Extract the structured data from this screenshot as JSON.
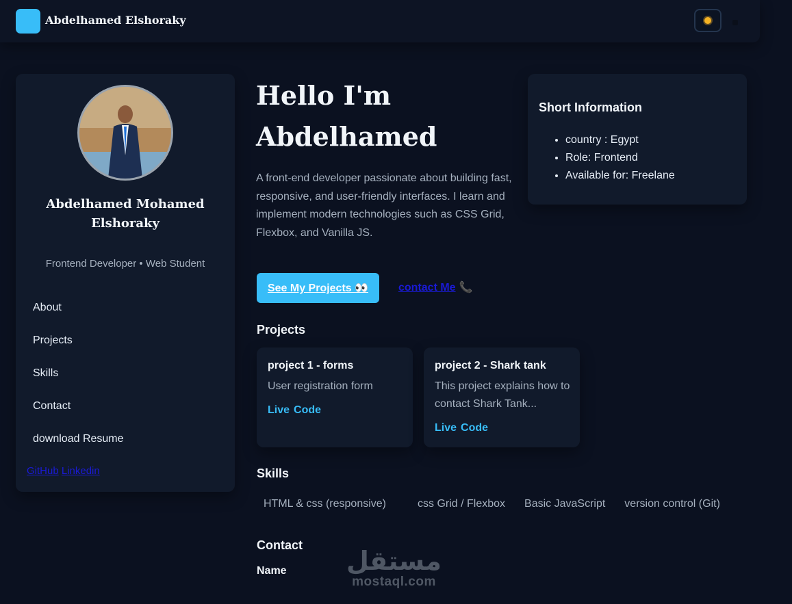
{
  "header": {
    "brand": "Abdelhamed Elshoraky",
    "theme_icon": "sun-icon"
  },
  "sidebar": {
    "name": "Abdelhamed Mohamed Elshoraky",
    "subtitle": "Frontend Developer • Web Student",
    "nav": [
      "About",
      "Projects",
      "Skills",
      "Contact",
      "download Resume"
    ],
    "links": [
      "GitHub",
      "Linkedin"
    ]
  },
  "hero": {
    "title_line1": "Hello I'm",
    "title_line2": "Abdelhamed",
    "description": "A front-end developer passionate about building fast, responsive, and user-friendly interfaces. I learn and implement modern technologies such as CSS Grid, Flexbox, and Vanilla JS.",
    "primary_button": "See My Projects 👀",
    "secondary_link": "contact Me",
    "phone_glyph": "📞"
  },
  "short_info": {
    "title": "Short Information",
    "items": [
      "country : Egypt",
      "Role: Frontend",
      "Available for: Freelane"
    ]
  },
  "projects": {
    "title": "Projects",
    "items": [
      {
        "title": "project 1 - forms",
        "description": "User registration form",
        "live": "Live",
        "code": "Code"
      },
      {
        "title": "project 2 - Shark tank",
        "description": "This project explains how to contact Shark Tank...",
        "live": "Live",
        "code": "Code"
      }
    ]
  },
  "skills": {
    "title": "Skills",
    "items": [
      "HTML & css (responsive)",
      "css Grid / Flexbox",
      "Basic JavaScript",
      "version control (Git)"
    ]
  },
  "contact": {
    "title": "Contact",
    "name_label": "Name"
  },
  "watermark": {
    "arabic": "مستقل",
    "latin": "mostaql.com"
  },
  "colors": {
    "background": "#0b1120",
    "card": "#111a2b",
    "accent": "#38bdf8",
    "link": "#1a1ad6"
  }
}
